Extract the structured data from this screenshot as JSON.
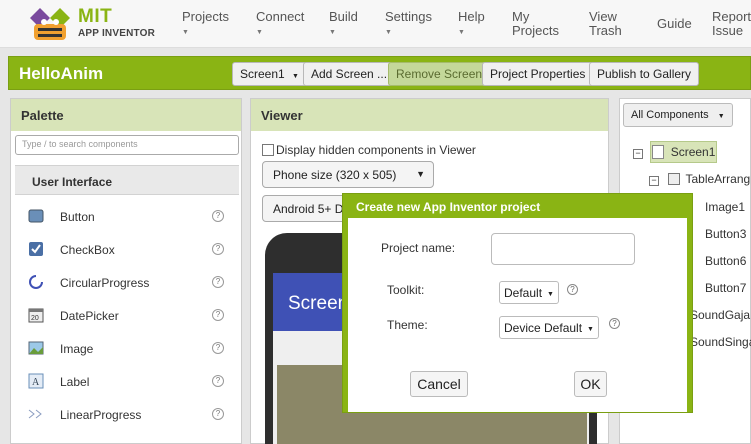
{
  "logo": {
    "mit": "MIT",
    "app_inventor": "APP INVENTOR"
  },
  "nav": [
    {
      "label": "Projects",
      "dropdown": true
    },
    {
      "label": "Connect",
      "dropdown": true
    },
    {
      "label": "Build",
      "dropdown": true
    },
    {
      "label": "Settings",
      "dropdown": true
    },
    {
      "label": "Help",
      "dropdown": true
    },
    {
      "label": "My Projects",
      "dropdown": false
    },
    {
      "label": "View Trash",
      "dropdown": false
    },
    {
      "label": "Guide",
      "dropdown": false
    },
    {
      "label": "Report Issue",
      "dropdown": false
    }
  ],
  "project": {
    "name": "HelloAnim",
    "screen_select": "Screen1",
    "add_screen": "Add Screen ...",
    "remove_screen": "Remove Screen",
    "project_properties": "Project Properties",
    "publish": "Publish to Gallery"
  },
  "palette": {
    "title": "Palette",
    "search_placeholder": "Type / to search components",
    "section": "User Interface",
    "items": [
      {
        "label": "Button",
        "icon": "button-icon"
      },
      {
        "label": "CheckBox",
        "icon": "checkbox-icon"
      },
      {
        "label": "CircularProgress",
        "icon": "circular-progress-icon"
      },
      {
        "label": "DatePicker",
        "icon": "datepicker-icon"
      },
      {
        "label": "Image",
        "icon": "image-icon"
      },
      {
        "label": "Label",
        "icon": "label-icon"
      },
      {
        "label": "LinearProgress",
        "icon": "linear-progress-icon"
      }
    ],
    "help_glyph": "?"
  },
  "viewer": {
    "title": "Viewer",
    "display_hidden": "Display hidden components in Viewer",
    "phone_size": "Phone size (320 x 505)",
    "android_select": "Android 5+ D",
    "screen_title": "Screen"
  },
  "components": {
    "dropdown": "All Components",
    "tree": [
      "Screen1",
      "TableArrang",
      "Image1",
      "Button3",
      "Button6",
      "Button7",
      "SoundGaja",
      "SoundSinga"
    ]
  },
  "modal": {
    "title": "Create new App Inventor project",
    "project_name_label": "Project name:",
    "project_name_value": "",
    "toolkit_label": "Toolkit:",
    "toolkit_value": "Default",
    "theme_label": "Theme:",
    "theme_value": "Device Default",
    "cancel": "Cancel",
    "ok": "OK"
  },
  "colors": {
    "brand_green": "#8ab414",
    "panel_head": "#d8e4b8",
    "app_bar": "#3f51b5"
  }
}
